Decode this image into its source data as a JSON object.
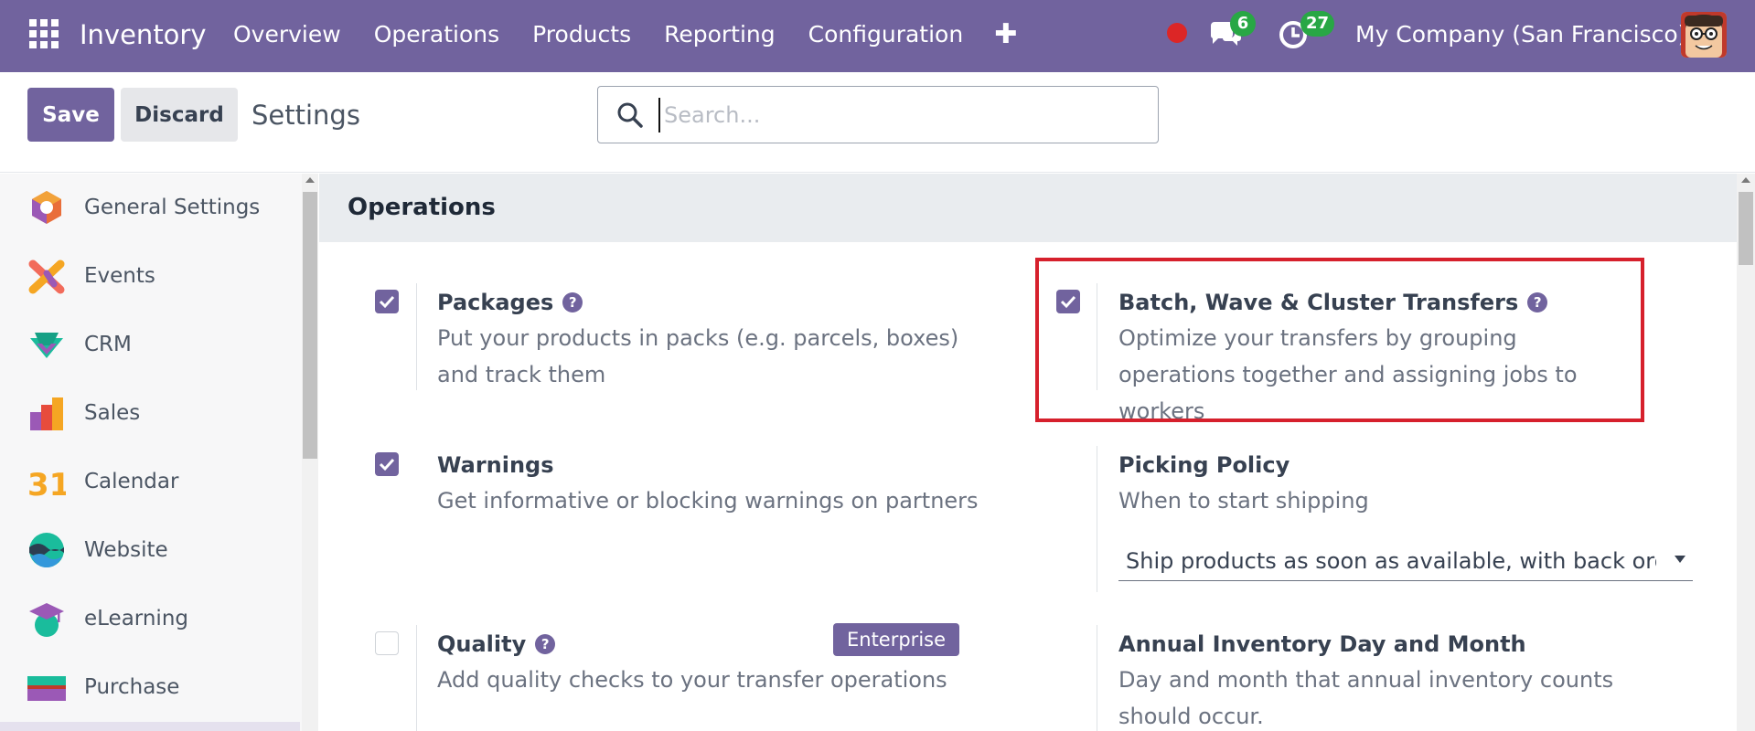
{
  "navbar": {
    "app_name": "Inventory",
    "menu": [
      "Overview",
      "Operations",
      "Products",
      "Reporting",
      "Configuration"
    ],
    "plus_symbol": "✚",
    "messages_count": "6",
    "activities_count": "27",
    "company": "My Company (San Francisco)",
    "accent_color": "#71639e"
  },
  "control": {
    "save_label": "Save",
    "discard_label": "Discard",
    "title": "Settings",
    "search_placeholder": "Search..."
  },
  "sidebar": {
    "items": [
      {
        "label": "General Settings",
        "icon": "general-settings-icon"
      },
      {
        "label": "Events",
        "icon": "events-icon"
      },
      {
        "label": "CRM",
        "icon": "crm-icon"
      },
      {
        "label": "Sales",
        "icon": "sales-icon"
      },
      {
        "label": "Calendar",
        "icon": "calendar-icon",
        "icon_text": "31"
      },
      {
        "label": "Website",
        "icon": "website-icon"
      },
      {
        "label": "eLearning",
        "icon": "elearning-icon"
      },
      {
        "label": "Purchase",
        "icon": "purchase-icon"
      }
    ]
  },
  "main": {
    "section_title": "Operations",
    "settings": {
      "packages": {
        "title": "Packages",
        "description": "Put your products in packs (e.g. parcels, boxes) and track them",
        "checked": true
      },
      "batch": {
        "title": "Batch, Wave & Cluster Transfers",
        "description": "Optimize your transfers by grouping operations together and assigning jobs to workers",
        "checked": true
      },
      "warnings": {
        "title": "Warnings",
        "description": "Get informative or blocking warnings on partners",
        "checked": true
      },
      "picking_policy": {
        "title": "Picking Policy",
        "description": "When to start shipping",
        "selected": "Ship products as soon as available, with back orde"
      },
      "quality": {
        "title": "Quality",
        "description": "Add quality checks to your transfer operations",
        "checked": false,
        "badge": "Enterprise"
      },
      "annual_inventory": {
        "title": "Annual Inventory Day and Month",
        "description": "Day and month that annual inventory counts should occur."
      }
    },
    "help_symbol": "?"
  }
}
